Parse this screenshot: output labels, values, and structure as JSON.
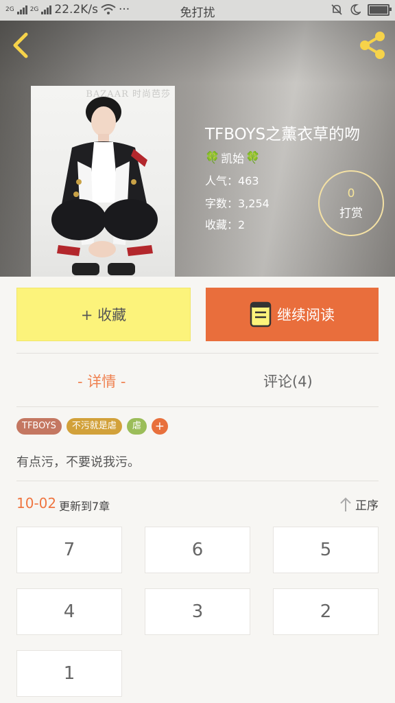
{
  "status_bar": {
    "network_speed": "22.2K/s",
    "signal_labels": [
      "2G",
      "2G"
    ],
    "dots": "···",
    "mode": "免打扰"
  },
  "cover": {
    "magazine_text": "BAZAAR 时尚芭莎"
  },
  "book": {
    "title": "TFBOYS之薰衣草的吻",
    "author_prefix_icon": "🍀",
    "author": "凯始",
    "author_suffix_icon": "🍀",
    "popularity": "人气：463",
    "word_count": "字数：3,254",
    "favorites": "收藏：2"
  },
  "reward": {
    "count": "0",
    "label": "打赏"
  },
  "actions": {
    "favorite_label": "+ 收藏",
    "read_label": "继续阅读"
  },
  "tabs": {
    "detail": "- 详情 -",
    "comments": "评论(4)"
  },
  "tags": [
    {
      "label": "TFBOYS",
      "color": "#c47761"
    },
    {
      "label": "不污就是虐",
      "color": "#d2a13a"
    },
    {
      "label": "虐",
      "color": "#9bbd59"
    },
    {
      "label": "+",
      "color": "#e8703c"
    }
  ],
  "description": "有点污，不要说我污。",
  "updates": {
    "date": "10-02",
    "text": "更新到7章",
    "sort_label": "正序"
  },
  "chapters": [
    "7",
    "6",
    "5",
    "4",
    "3",
    "2",
    "1"
  ],
  "colors": {
    "accent_orange": "#e96e3c",
    "favorite_yellow": "#fcf37b",
    "share_icon": "#f6d34a"
  }
}
